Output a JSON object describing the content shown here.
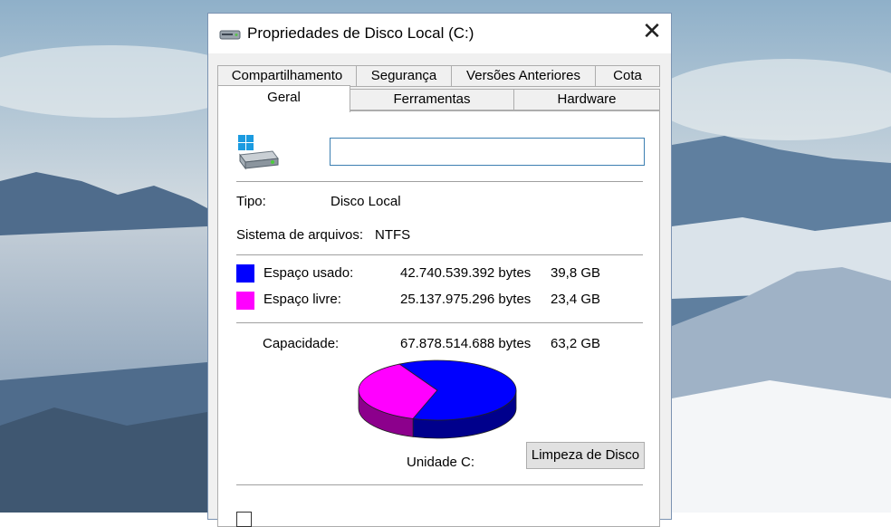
{
  "dialog": {
    "title": "Propriedades de Disco Local (C:)",
    "close_glyph": "✕",
    "tabs_row1": [
      "Compartilhamento",
      "Segurança",
      "Versões Anteriores",
      "Cota"
    ],
    "tabs_row2": [
      "Geral",
      "Ferramentas",
      "Hardware"
    ],
    "active_tab": "Geral"
  },
  "general": {
    "drive_name_value": "",
    "type_label": "Tipo:",
    "type_value": "Disco Local",
    "fs_label": "Sistema de arquivos:",
    "fs_value": "NTFS",
    "used": {
      "label": "Espaço usado:",
      "bytes": "42.740.539.392 bytes",
      "size": "39,8 GB",
      "color": "#0000ff"
    },
    "free": {
      "label": "Espaço livre:",
      "bytes": "25.137.975.296 bytes",
      "size": "23,4 GB",
      "color": "#ff00ff"
    },
    "capacity": {
      "label": "Capacidade:",
      "bytes": "67.878.514.688 bytes",
      "size": "63,2 GB"
    },
    "drive_label": "Unidade C:",
    "cleanup_button": "Limpeza de Disco"
  },
  "pie": {
    "used_fraction": 0.6297
  },
  "icons": [
    "drive-icon",
    "close-icon",
    "red-arrow-icon"
  ],
  "colors": {
    "accent_border": "#3c7fb1",
    "arrow": "#e01010"
  }
}
